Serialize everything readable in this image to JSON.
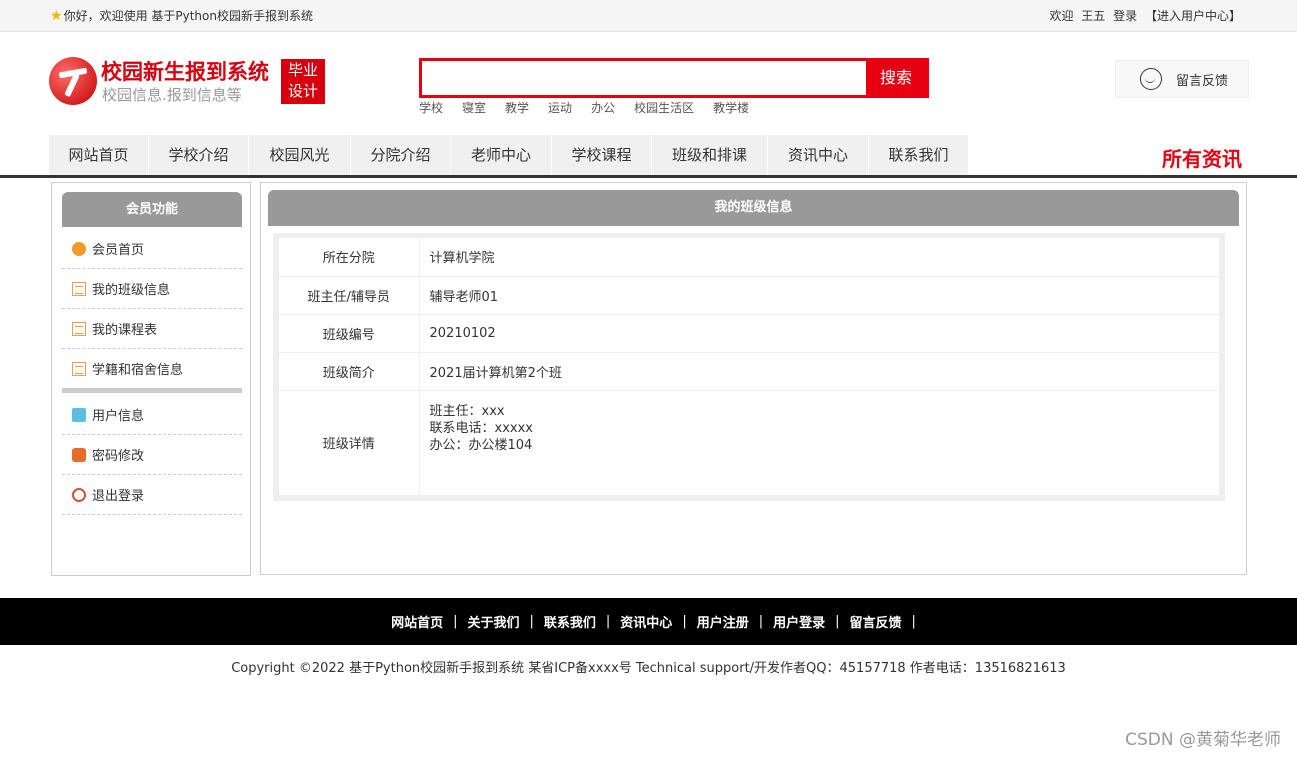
{
  "topbar": {
    "welcome": "你好，欢迎使用 基于Python校园新手报到系统",
    "greeting": "欢迎",
    "username": "王五",
    "login": "登录",
    "user_center": "【进入用户中心】"
  },
  "header": {
    "site_title": "校园新生报到系统",
    "site_subtitle": "校园信息.报到信息等",
    "tag_line1": "毕业",
    "tag_line2": "设计",
    "search_button": "搜索",
    "search_value": "",
    "hot_words": [
      "学校",
      "寝室",
      "教学",
      "运动",
      "办公",
      "校园生活区",
      "教学楼"
    ],
    "feedback": "留言反馈"
  },
  "nav": {
    "items": [
      "网站首页",
      "学校介绍",
      "校园风光",
      "分院介绍",
      "老师中心",
      "学校课程",
      "班级和排课",
      "资讯中心",
      "联系我们"
    ],
    "all_news": "所有资讯"
  },
  "sidebar": {
    "title": "会员功能",
    "items": [
      "会员首页",
      "我的班级信息",
      "我的课程表",
      "学籍和宿舍信息",
      "用户信息",
      "密码修改",
      "退出登录"
    ]
  },
  "main": {
    "title": "我的班级信息",
    "rows": [
      {
        "label": "所在分院",
        "value": "计算机学院"
      },
      {
        "label": "班主任/辅导员",
        "value": "辅导老师01"
      },
      {
        "label": "班级编号",
        "value": "20210102"
      },
      {
        "label": "班级简介",
        "value": "2021届计算机第2个班"
      }
    ],
    "detail_label": "班级详情",
    "detail_lines": [
      "班主任：xxx",
      "联系电话：xxxxx",
      "办公：办公楼104"
    ]
  },
  "footer": {
    "links": [
      "网站首页",
      "关于我们",
      "联系我们",
      "资讯中心",
      "用户注册",
      "用户登录",
      "留言反馈"
    ],
    "copyright": "Copyright ©2022 基于Python校园新手报到系统 某省ICP备xxxx号    Technical support/开发作者QQ：45157718     作者电话：13516821613"
  },
  "watermark": "CSDN @黄菊华老师",
  "colors": {
    "brand_red": "#e60012",
    "header_gray": "#999999",
    "footer_bg": "#000000"
  }
}
